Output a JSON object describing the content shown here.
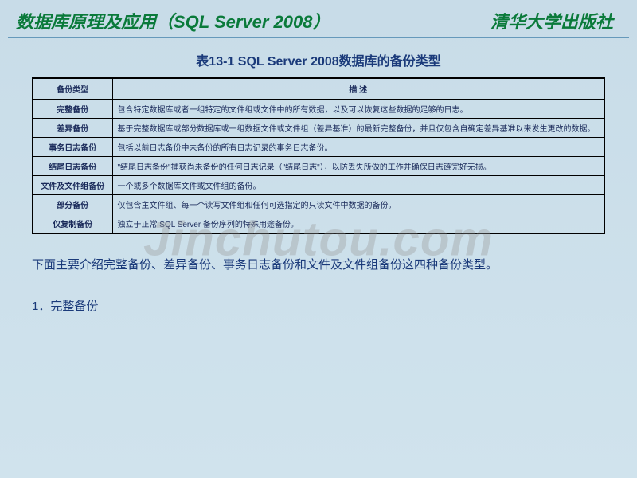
{
  "header": {
    "titleLeft": "数据库原理及应用（SQL Server 2008）",
    "titleRight": "清华大学出版社"
  },
  "tableTitle": "表13-1  SQL Server 2008数据库的备份类型",
  "table": {
    "headers": {
      "col1": "备份类型",
      "col2": "描  述"
    },
    "rows": [
      {
        "type": "完整备份",
        "desc": "包含特定数据库或者一组特定的文件组或文件中的所有数据，以及可以恢复这些数据的足够的日志。"
      },
      {
        "type": "差异备份",
        "desc": "基于完整数据库或部分数据库或一组数据文件或文件组（差异基准）的最新完整备份，并且仅包含自确定差异基准以来发生更改的数据。"
      },
      {
        "type": "事务日志备份",
        "desc": "包括以前日志备份中未备份的所有日志记录的事务日志备份。"
      },
      {
        "type": "结尾日志备份",
        "desc": "\"结尾日志备份\"捕获尚未备份的任何日志记录（\"结尾日志\"），以防丢失所做的工作并确保日志链完好无损。"
      },
      {
        "type": "文件及文件组备份",
        "desc": "一个或多个数据库文件或文件组的备份。"
      },
      {
        "type": "部分备份",
        "desc": "仅包含主文件组、每一个读写文件组和任何可选指定的只读文件中数据的备份。"
      },
      {
        "type": "仅复制备份",
        "desc": "独立于正常 SQL Server 备份序列的特殊用途备份。"
      }
    ]
  },
  "bodyText": "下面主要介绍完整备份、差异备份、事务日志备份和文件及文件组备份这四种备份类型。",
  "sectionHeading": "1．完整备份",
  "watermark": "Jinchutou.com"
}
